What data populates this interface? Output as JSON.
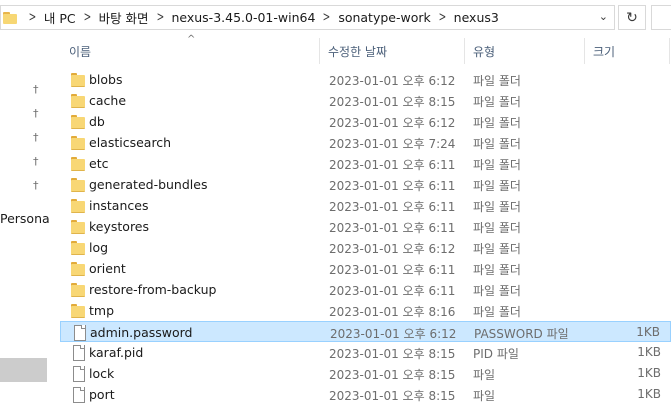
{
  "address": {
    "breadcrumbs": [
      "내 PC",
      "바탕 화면",
      "nexus-3.45.0-01-win64",
      "sonatype-work",
      "nexus3"
    ],
    "separator": ">",
    "dropdown_glyph": "⌄",
    "refresh_glyph": "↻"
  },
  "nav": {
    "pins": [
      "pin-icon",
      "pin-icon",
      "pin-icon",
      "pin-icon",
      "pin-icon"
    ],
    "pin_glyph": "📌",
    "item_personal": "Personal"
  },
  "columns": {
    "name": "이름",
    "date": "수정한 날짜",
    "type": "유형",
    "size": "크기",
    "sort_glyph": "^"
  },
  "files": [
    {
      "name": "blobs",
      "date": "2023-01-01 오후 6:12",
      "type": "파일 폴더",
      "size": "",
      "kind": "folder"
    },
    {
      "name": "cache",
      "date": "2023-01-01 오후 8:15",
      "type": "파일 폴더",
      "size": "",
      "kind": "folder"
    },
    {
      "name": "db",
      "date": "2023-01-01 오후 6:12",
      "type": "파일 폴더",
      "size": "",
      "kind": "folder"
    },
    {
      "name": "elasticsearch",
      "date": "2023-01-01 오후 7:24",
      "type": "파일 폴더",
      "size": "",
      "kind": "folder"
    },
    {
      "name": "etc",
      "date": "2023-01-01 오후 6:11",
      "type": "파일 폴더",
      "size": "",
      "kind": "folder"
    },
    {
      "name": "generated-bundles",
      "date": "2023-01-01 오후 6:11",
      "type": "파일 폴더",
      "size": "",
      "kind": "folder"
    },
    {
      "name": "instances",
      "date": "2023-01-01 오후 6:11",
      "type": "파일 폴더",
      "size": "",
      "kind": "folder"
    },
    {
      "name": "keystores",
      "date": "2023-01-01 오후 6:11",
      "type": "파일 폴더",
      "size": "",
      "kind": "folder"
    },
    {
      "name": "log",
      "date": "2023-01-01 오후 6:12",
      "type": "파일 폴더",
      "size": "",
      "kind": "folder"
    },
    {
      "name": "orient",
      "date": "2023-01-01 오후 6:11",
      "type": "파일 폴더",
      "size": "",
      "kind": "folder"
    },
    {
      "name": "restore-from-backup",
      "date": "2023-01-01 오후 6:11",
      "type": "파일 폴더",
      "size": "",
      "kind": "folder"
    },
    {
      "name": "tmp",
      "date": "2023-01-01 오후 8:16",
      "type": "파일 폴더",
      "size": "",
      "kind": "folder"
    },
    {
      "name": "admin.password",
      "date": "2023-01-01 오후 6:12",
      "type": "PASSWORD 파일",
      "size": "1KB",
      "kind": "file",
      "selected": true
    },
    {
      "name": "karaf.pid",
      "date": "2023-01-01 오후 8:15",
      "type": "PID 파일",
      "size": "1KB",
      "kind": "file"
    },
    {
      "name": "lock",
      "date": "2023-01-01 오후 8:15",
      "type": "파일",
      "size": "1KB",
      "kind": "file"
    },
    {
      "name": "port",
      "date": "2023-01-01 오후 8:15",
      "type": "파일",
      "size": "1KB",
      "kind": "file"
    }
  ]
}
